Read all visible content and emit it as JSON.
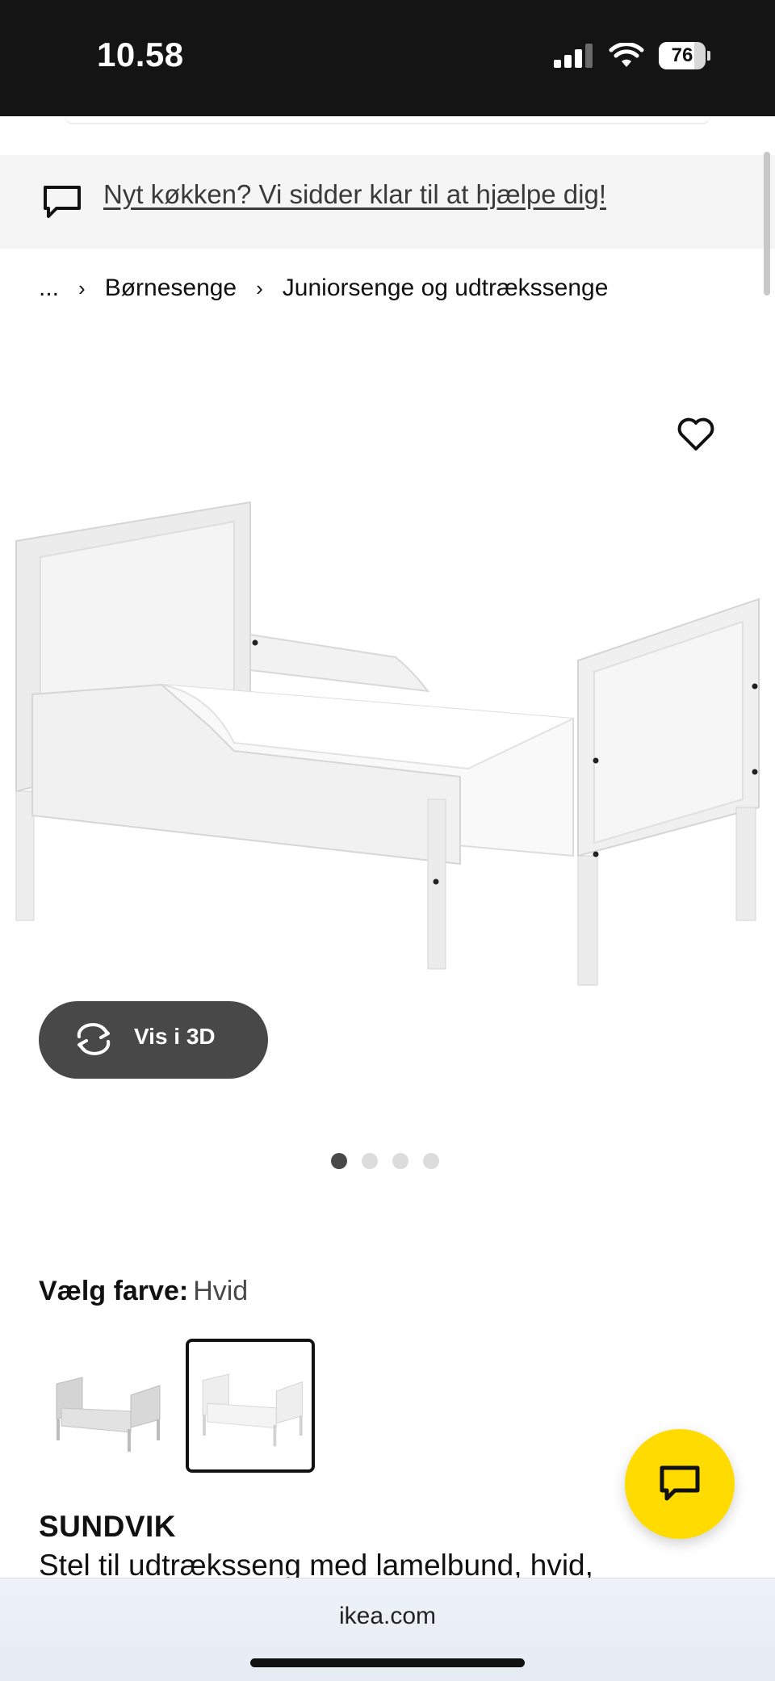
{
  "status_bar": {
    "time": "10.58",
    "battery_level": "76",
    "battery_fraction": 0.76
  },
  "banner": {
    "text": "Nyt køkken? Vi sidder klar til at hjælpe dig!",
    "icon": "chat-bubble-icon"
  },
  "breadcrumb": {
    "items": [
      "...",
      "Børnesenge",
      "Juniorsenge og udtrækssenge"
    ]
  },
  "gallery": {
    "favorite_icon": "heart-icon",
    "view_3d_label": "Vis i 3D",
    "view_3d_icon": "rotate-icon",
    "dot_count": 4,
    "active_dot": 0
  },
  "color_selector": {
    "label": "Vælg farve:",
    "value": "Hvid",
    "selected_index": 1
  },
  "product": {
    "name": "SUNDVIK",
    "description": "Stel til udtræksseng med lamelbund, hvid,"
  },
  "chat_button": {
    "icon": "chat-icon"
  },
  "browser": {
    "url": "ikea.com"
  },
  "colors": {
    "accent_yellow": "#ffdb00",
    "button_dark": "#484848",
    "status_bar": "#141414"
  }
}
